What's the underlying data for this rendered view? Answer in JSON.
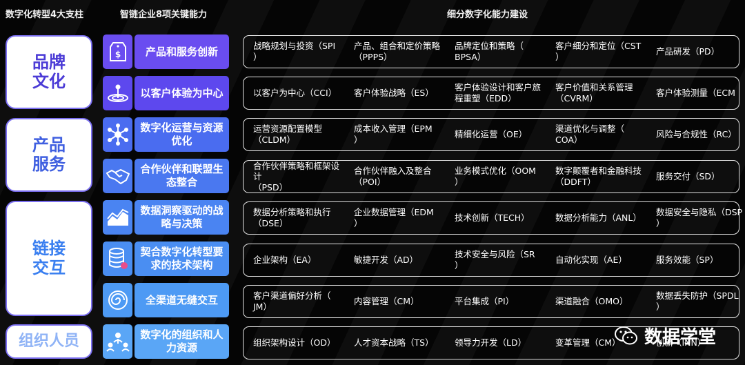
{
  "headers": {
    "pillars": "数字化转型4大支柱",
    "capabilities": "智链企业8项关键能力",
    "details": "细分数字化能力建设"
  },
  "pillars": [
    "品牌\n文化",
    "产品\n服务",
    "链接\n交互",
    "组织人员"
  ],
  "rows": [
    {
      "icon": "price-tag-icon",
      "label": "产品和服务创新",
      "color": "#6a4df0",
      "items": [
        "战略规划与投资（SPI\n）",
        "产品、组合和定价策略\n（PPPS）",
        "品牌定位和策略（\nBPSA）",
        "客户细分和定位（CST\n）",
        "产品研发（PD）"
      ]
    },
    {
      "icon": "target-icon",
      "label": "以客户体验为中心",
      "color": "#5d48ee",
      "items": [
        "以客户为中心（CCI）",
        "客户体验战略（ES）",
        "客户体验设计和客户旅\n程重塑（EDD）",
        "客户价值和关系管理\n（CVRM）",
        "客户体验测量（ECM"
      ]
    },
    {
      "icon": "network-icon",
      "label": "数字化运营与资源优化",
      "color": "#4a6cf0",
      "items": [
        "运营资源配置模型\n（CLDM）",
        "成本收入管理（EPM\n）",
        "精细化运营（OE）",
        "渠道优化与调整（\nCOA）",
        "风险与合规性（RC）"
      ]
    },
    {
      "icon": "handshake-icon",
      "label": "合作伙伴和联盟生态整合",
      "color": "#4a78f0",
      "items": [
        "合作伙伴策略和框架设\n计\n（PSD）",
        "合作伙伴融入及整合\n（POI）",
        "业务模式优化（OOM\n）",
        "数字颠覆者和金融科技\n（DDFT）",
        "服务交付（SD）"
      ]
    },
    {
      "icon": "chart-icon",
      "label": "数据洞察驱动的战略与决策",
      "color": "#4a84f2",
      "items": [
        "数据分析策略和执行\n（DSE）",
        "企业数据管理（EDM\n）",
        "技术创新（TECH）",
        "数据分析能力（ANL）",
        "数据安全与隐私（DSP\n）"
      ]
    },
    {
      "icon": "database-icon",
      "label": "契合数字化转型要求的技术架构",
      "color": "#4a8ef2",
      "items": [
        "企业架构（EA）",
        "敏捷开发（AD）",
        "技术安全与风险（SR\n）",
        "自动化实现（AE）",
        "服务效能（SP）"
      ]
    },
    {
      "icon": "spiral-icon",
      "label": "全渠道无缝交互",
      "color": "#4d9af4",
      "items": [
        "客户渠道偏好分析（\nJM）",
        "内容管理（CM）",
        "平台集成（PI）",
        "渠道融合（OMO）",
        "数据丢失防护（SPDL\n）"
      ]
    },
    {
      "icon": "people-icon",
      "label": "数字化的组织和人力资源",
      "color": "#5aa6f6",
      "items": [
        "组织架构设计（OD）",
        "人才资本战略（TS）",
        "领导力开发（LD）",
        "变革管理（CM）",
        "创新（INN）"
      ]
    }
  ],
  "watermark": {
    "text": "数据学堂",
    "icon": "wechat-icon"
  }
}
